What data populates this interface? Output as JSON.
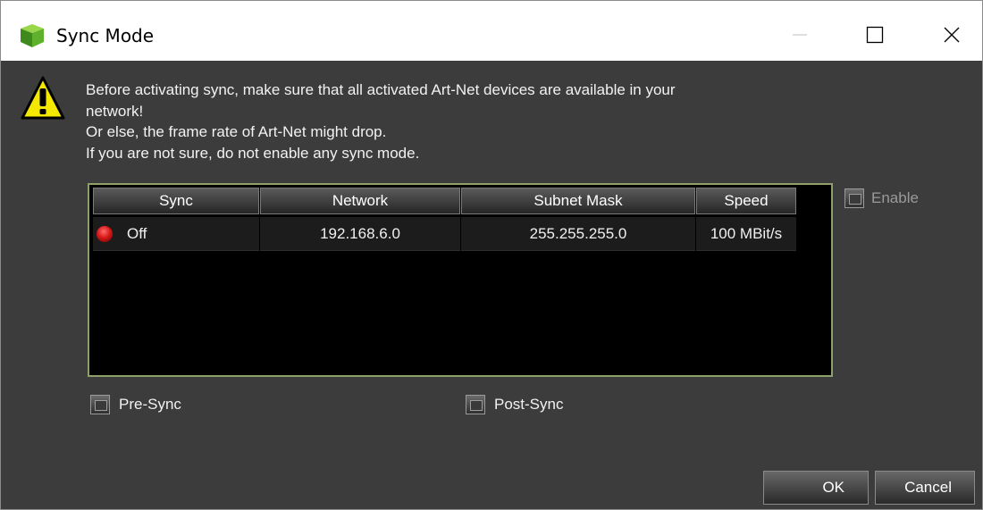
{
  "window": {
    "title": "Sync Mode",
    "icons": {
      "app": "green-cube-icon",
      "minimize": "minimize-icon",
      "maximize": "maximize-icon",
      "close": "close-icon",
      "warning": "warning-triangle-icon"
    }
  },
  "warning": {
    "lines": [
      "Before activating sync, make sure that all activated Art-Net devices are available in your",
      "network!",
      "Or else, the frame rate of Art-Net might drop.",
      "If you are not sure, do not enable any sync mode."
    ]
  },
  "table": {
    "columns": [
      "Sync",
      "Network",
      "Subnet Mask",
      "Speed"
    ],
    "rows": [
      {
        "sync": "Off",
        "network": "192.168.6.0",
        "subnet": "255.255.255.0",
        "speed": "100 MBit/s",
        "status_color": "#d81a1a"
      }
    ]
  },
  "options": {
    "enable_label": "Enable",
    "presync_label": "Pre-Sync",
    "postsync_label": "Post-Sync"
  },
  "buttons": {
    "ok": "OK",
    "cancel": "Cancel"
  },
  "colors": {
    "background": "#3c3c3c",
    "table_border": "#8ea06a",
    "warning_yellow": "#f5e800"
  }
}
